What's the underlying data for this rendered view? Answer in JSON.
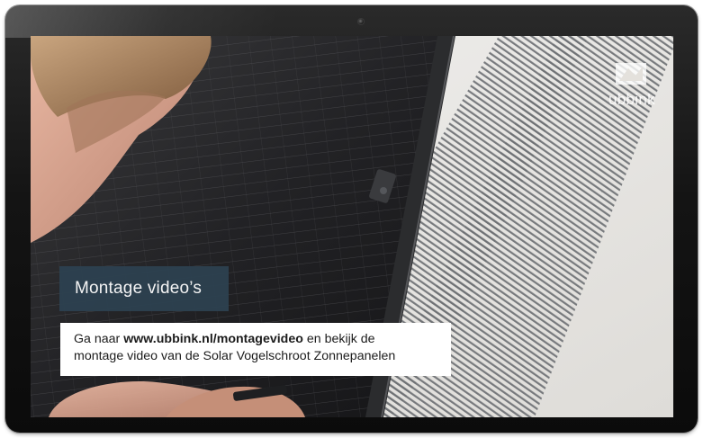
{
  "brand": {
    "logo_text": "ubbink"
  },
  "slide": {
    "title": "Montage video’s",
    "info": {
      "prefix": "Ga naar ",
      "link": "www.ubbink.nl/montagevideo",
      "suffix": " en bekijk de",
      "line2": "montage video van de Solar Vogelschroot Zonnepanelen"
    }
  },
  "colors": {
    "title_box": "#2d4150",
    "bezel": "#141414",
    "info_box": "#ffffff"
  },
  "icons": {
    "camera": "webcam-dot",
    "logo": "ubbink-house-logo"
  }
}
